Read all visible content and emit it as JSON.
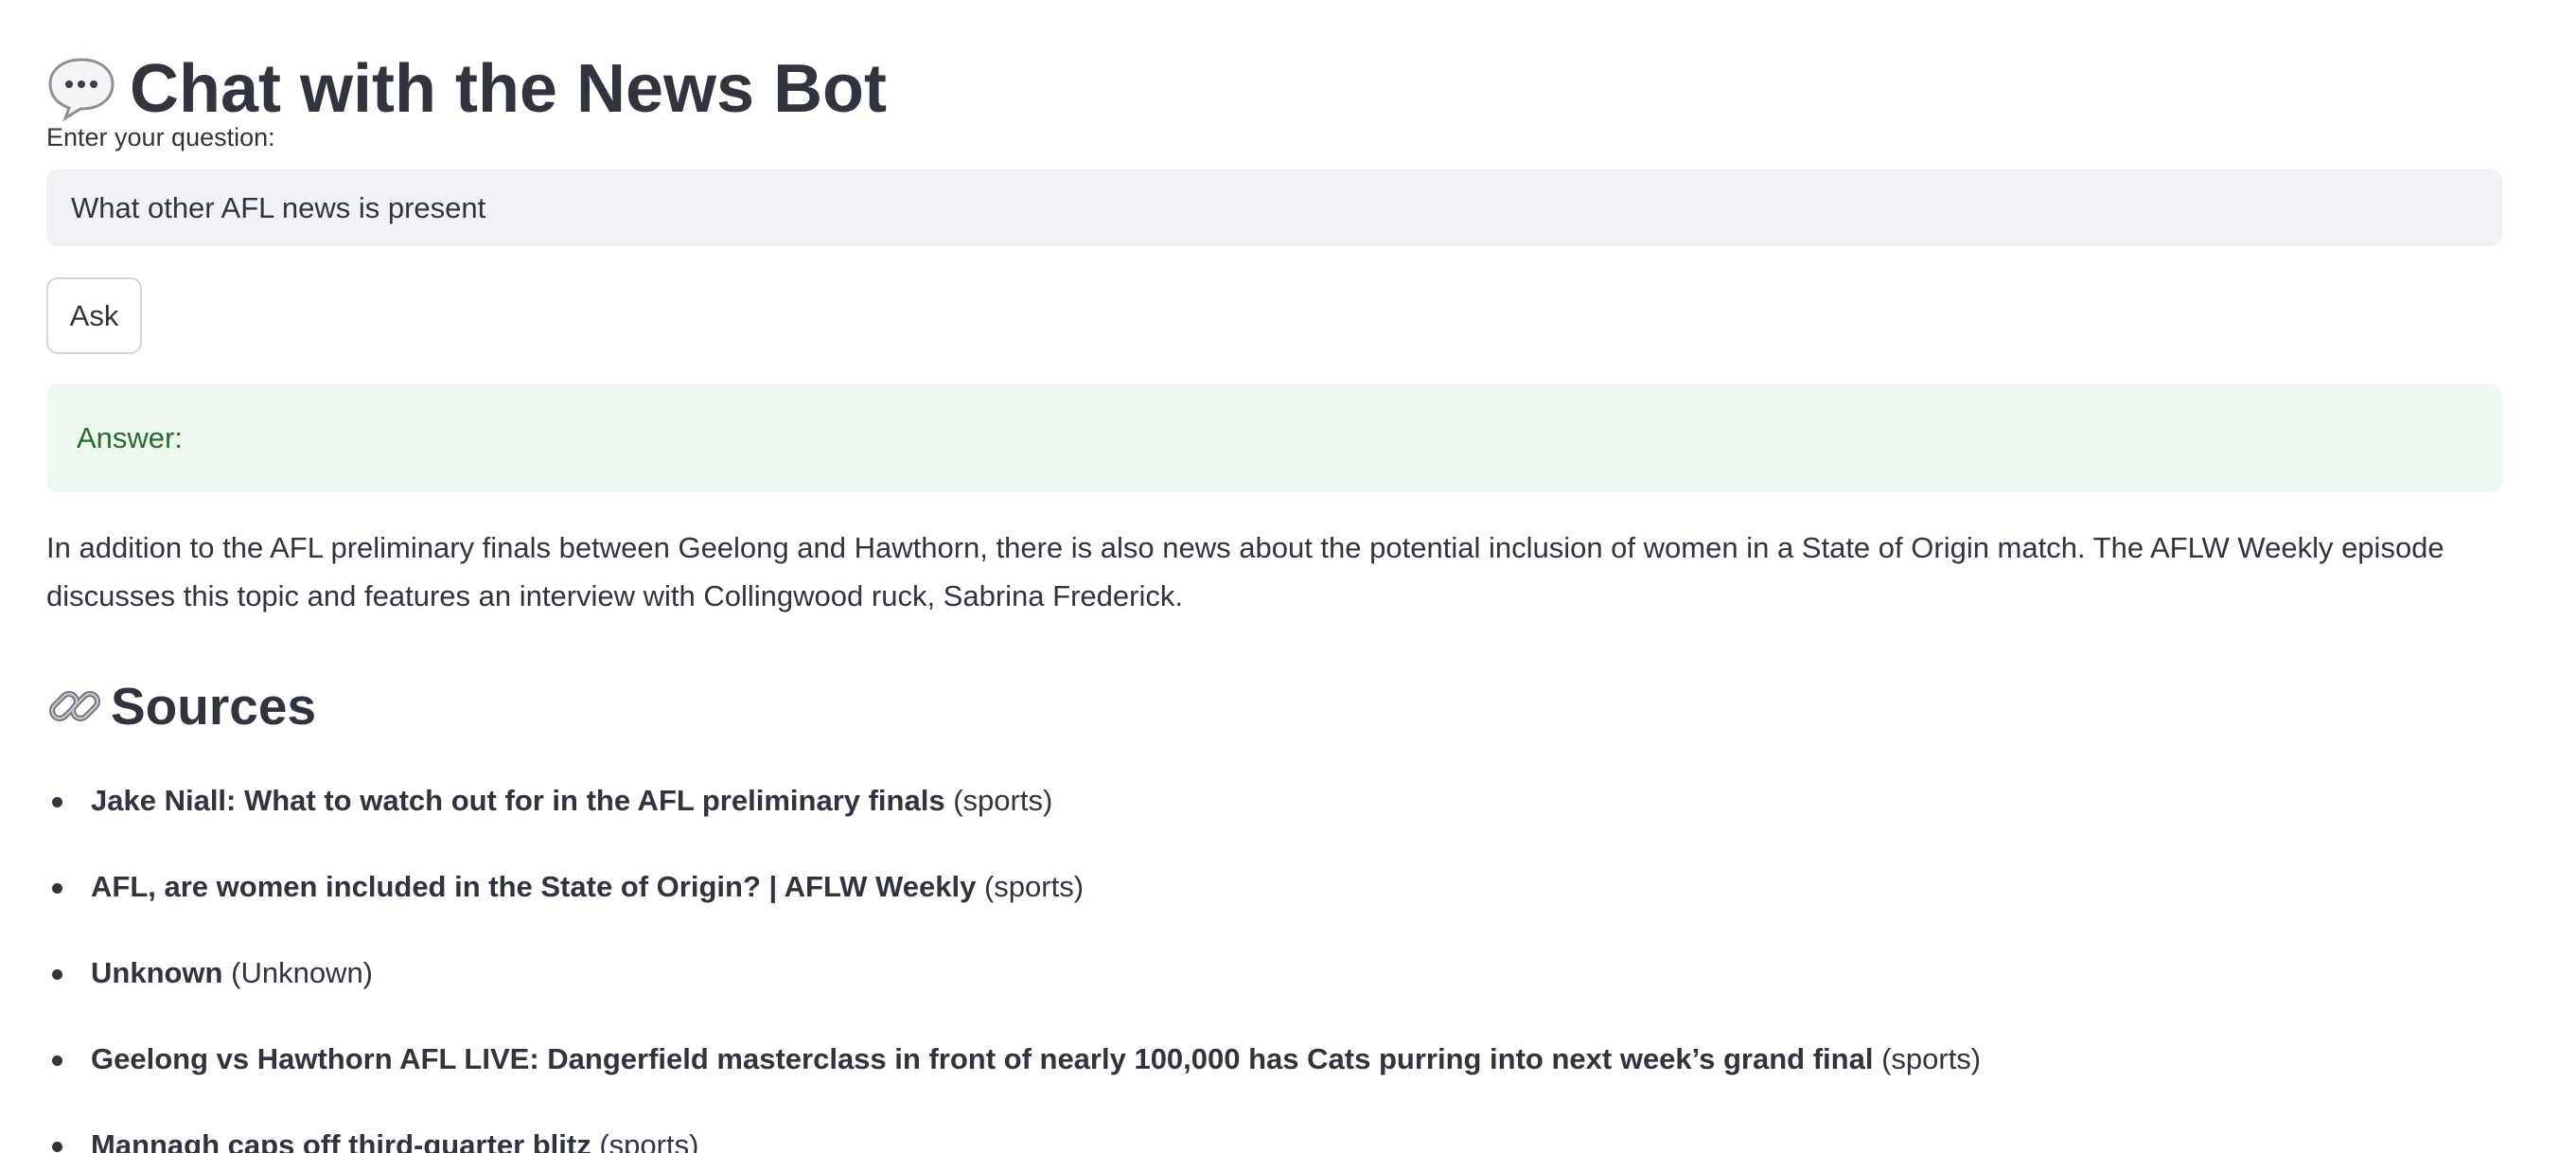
{
  "page": {
    "title_emoji": "speech-balloon-icon",
    "title": "Chat with the News Bot"
  },
  "question": {
    "label": "Enter your question:",
    "value": "What other AFL news is present"
  },
  "ask_button": {
    "label": "Ask"
  },
  "answer": {
    "label": "Answer:",
    "text": "In addition to the AFL preliminary finals between Geelong and Hawthorn, there is also news about the potential inclusion of women in a State of Origin match. The AFLW Weekly episode discusses this topic and features an interview with Collingwood ruck, Sabrina Frederick."
  },
  "sources": {
    "heading_emoji": "link-icon",
    "heading": "Sources",
    "items": [
      {
        "title": "Jake Niall: What to watch out for in the AFL preliminary finals",
        "category": "(sports)"
      },
      {
        "title": "AFL, are women included in the State of Origin? | AFLW Weekly",
        "category": "(sports)"
      },
      {
        "title": "Unknown",
        "category": "(Unknown)"
      },
      {
        "title": "Geelong vs Hawthorn AFL LIVE: Dangerfield masterclass in front of nearly 100,000 has Cats purring into next week’s grand final",
        "category": "(sports)"
      },
      {
        "title": "Mannagh caps off third-quarter blitz",
        "category": "(sports)"
      }
    ]
  },
  "colors": {
    "text": "#31333f",
    "input_bg": "#f0f2f6",
    "success_bg": "#edf8ee",
    "success_text": "#2a6a31"
  }
}
